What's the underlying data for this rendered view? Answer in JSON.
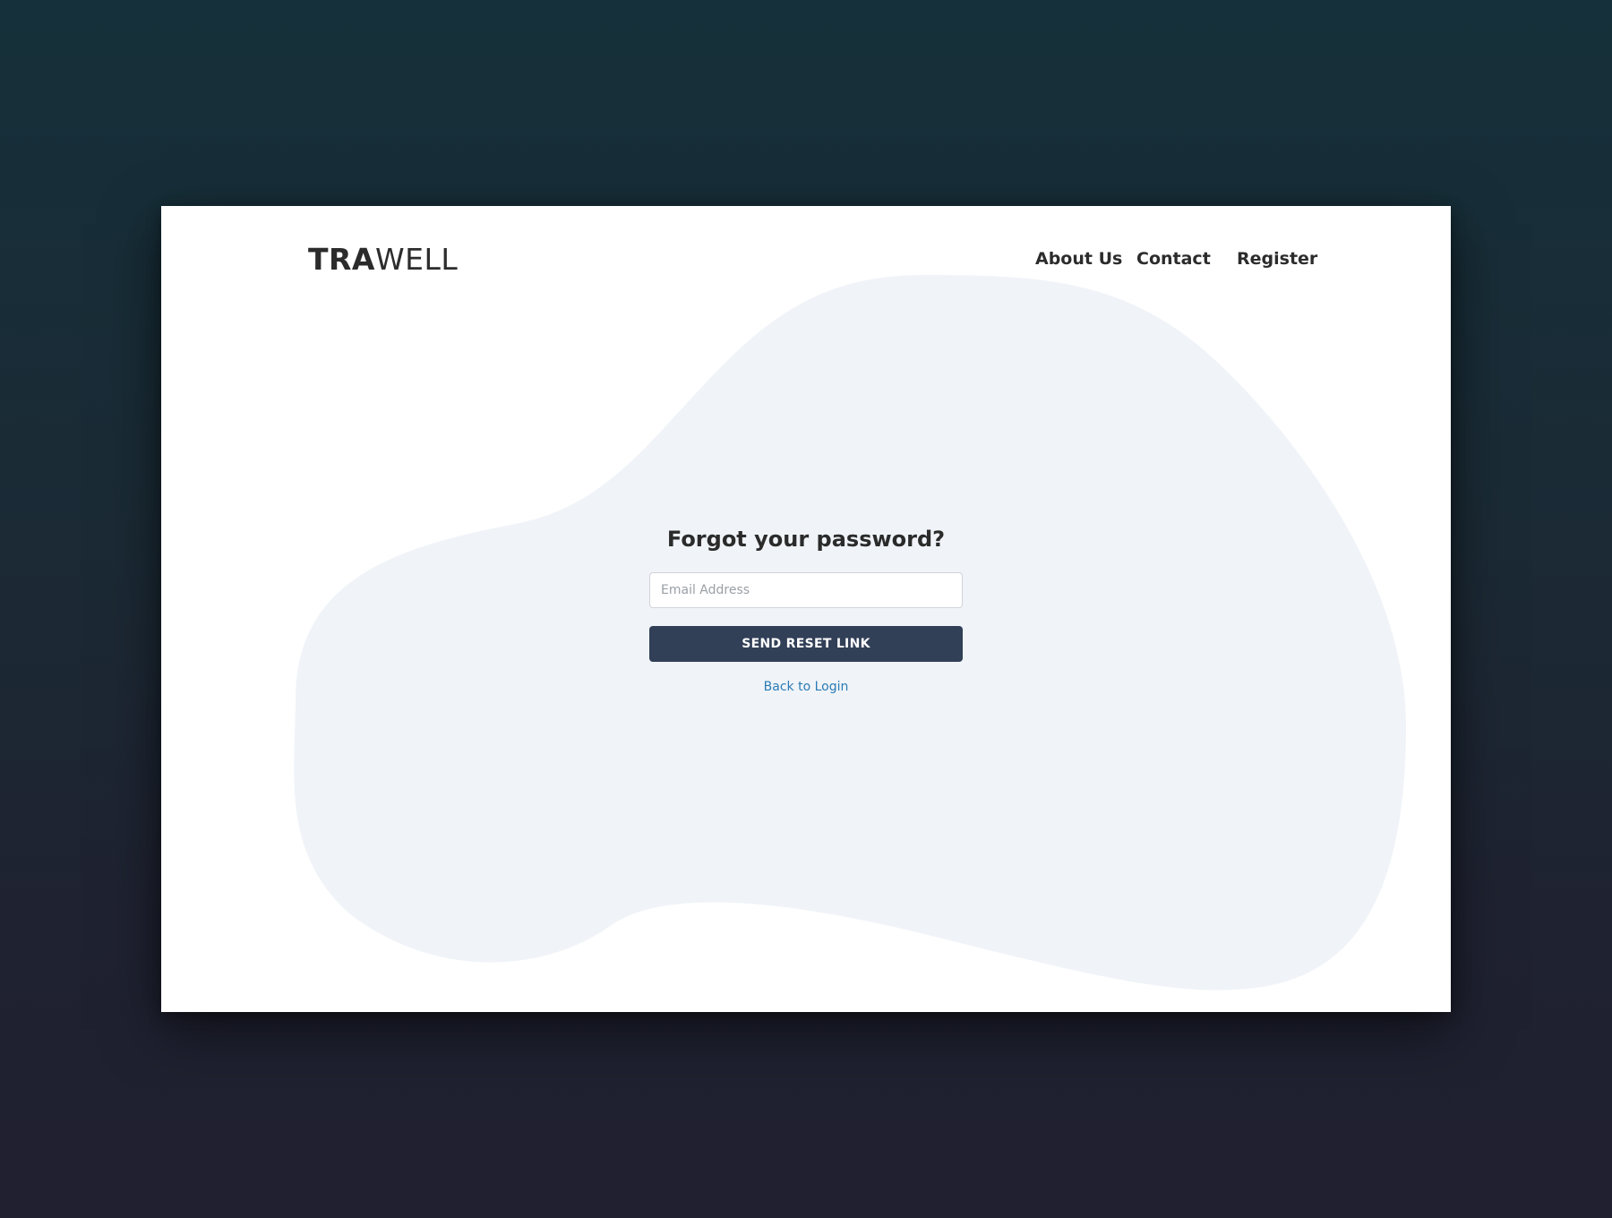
{
  "brand": {
    "logo_bold": "TRA",
    "logo_light": "WELL"
  },
  "nav": {
    "about": "About Us",
    "contact": "Contact",
    "register": "Register"
  },
  "form": {
    "title": "Forgot your password?",
    "email_placeholder": "Email Address",
    "email_value": "",
    "submit_label": "SEND RESET LINK",
    "back_link": "Back to Login"
  },
  "colors": {
    "background_top": "#15303a",
    "background_bottom": "#202030",
    "card": "#ffffff",
    "blob": "#f0f4f8",
    "button": "#313f57",
    "link": "#2b7bb5"
  }
}
